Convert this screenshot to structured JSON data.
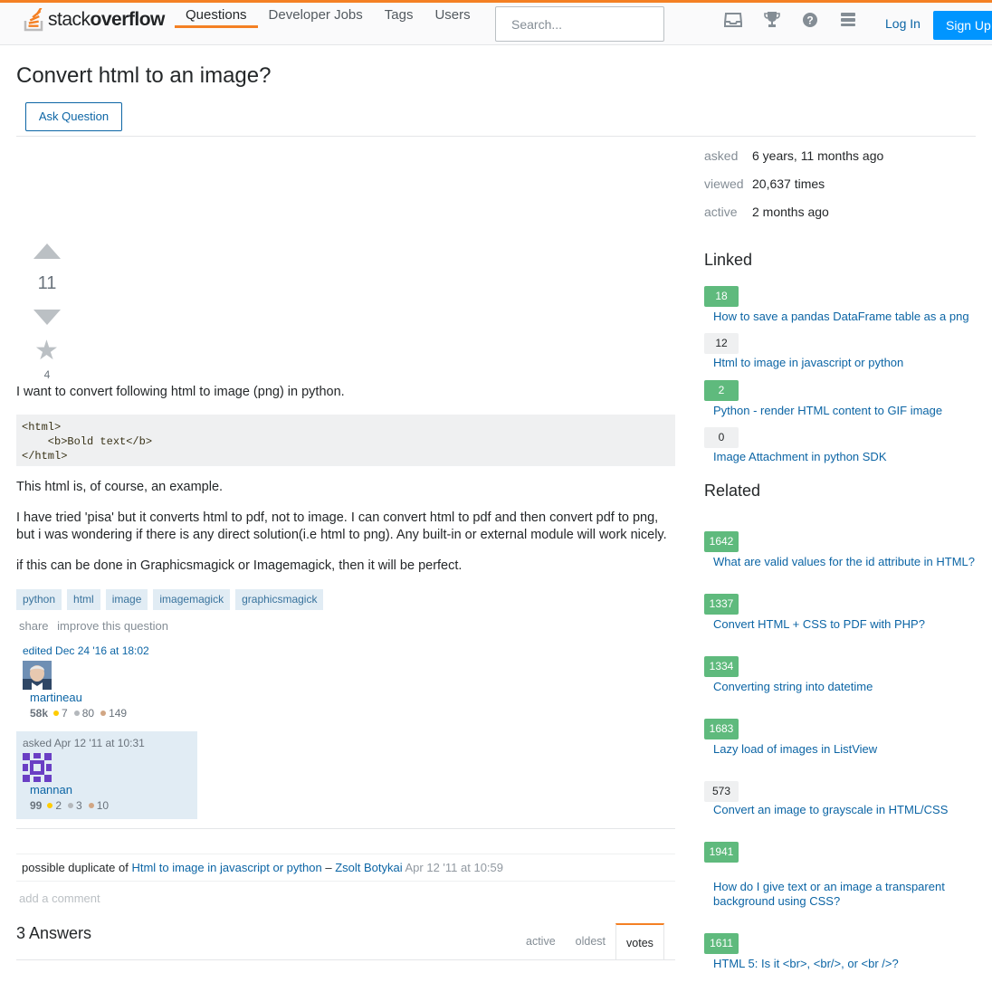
{
  "header": {
    "logo_text_light": "stack",
    "logo_text_bold": "overflow",
    "nav": [
      "Questions",
      "Developer Jobs",
      "Tags",
      "Users"
    ],
    "search_placeholder": "Search...",
    "login": "Log In",
    "signup": "Sign Up",
    "icons": [
      "inbox-icon",
      "trophy-icon",
      "help-icon",
      "site-switcher-icon"
    ]
  },
  "question": {
    "title": "Convert html to an image?",
    "ask_button": "Ask Question",
    "votes": "11",
    "favorites": "4",
    "p1": "I want to convert following html to image (png) in python.",
    "code": "<html>\n    <b>Bold text</b>\n</html>",
    "p2": "This html is, of course, an example.",
    "p3": "I have tried 'pisa' but it converts html to pdf, not to image. I can convert html to pdf and then convert pdf to png, but i was wondering if there is any direct solution(i.e html to png). Any built-in or external module will work nicely.",
    "p4": "if this can be done in Graphicsmagick or Imagemagick, then it will be perfect.",
    "tags": [
      "python",
      "html",
      "image",
      "imagemagick",
      "graphicsmagick"
    ],
    "menu": [
      "share",
      "improve this question"
    ],
    "edited": {
      "action": "edited Dec 24 '16 at 18:02",
      "user": "martineau",
      "rep": "58k",
      "gold": "7",
      "silver": "80",
      "bronze": "149"
    },
    "asked": {
      "action": "asked Apr 12 '11 at 10:31",
      "user": "mannan",
      "rep": "99",
      "gold": "2",
      "silver": "3",
      "bronze": "10"
    }
  },
  "comment": {
    "prefix": "possible duplicate of",
    "link": "Html to image in javascript or python",
    "dash": "–",
    "author": "Zsolt Botykai",
    "time": "Apr 12 '11 at 10:59"
  },
  "add_comment": "add a comment",
  "answers": {
    "title": "3 Answers",
    "tabs": [
      "active",
      "oldest",
      "votes"
    ],
    "active_tab": "votes"
  },
  "sidebar": {
    "meta": [
      {
        "label": "asked",
        "value": "6 years, 11 months ago"
      },
      {
        "label": "viewed",
        "value": "20,637 times"
      },
      {
        "label": "active",
        "value": "2 months ago"
      }
    ],
    "linked_title": "Linked",
    "linked": [
      {
        "score": "18",
        "accepted": true,
        "title": "How to save a pandas DataFrame table as a png"
      },
      {
        "score": "12",
        "accepted": false,
        "title": "Html to image in javascript or python"
      },
      {
        "score": "2",
        "accepted": true,
        "title": "Python - render HTML content to GIF image"
      },
      {
        "score": "0",
        "accepted": false,
        "title": "Image Attachment in python SDK"
      }
    ],
    "related_title": "Related",
    "related": [
      {
        "score": "1642",
        "accepted": true,
        "title": "What are valid values for the id attribute in HTML?"
      },
      {
        "score": "1337",
        "accepted": true,
        "title": "Convert HTML + CSS to PDF with PHP?"
      },
      {
        "score": "1334",
        "accepted": true,
        "title": "Converting string into datetime"
      },
      {
        "score": "1683",
        "accepted": true,
        "title": "Lazy load of images in ListView"
      },
      {
        "score": "573",
        "accepted": false,
        "title": "Convert an image to grayscale in HTML/CSS"
      },
      {
        "score": "1941",
        "accepted": true,
        "title": "How do I give text or an image a transparent background using CSS?"
      },
      {
        "score": "1611",
        "accepted": true,
        "title": "HTML 5: Is it <br>, <br/>, or <br />?"
      }
    ]
  },
  "colors": {
    "accent_orange": "#f48024",
    "link_blue": "#0c65a5",
    "accepted_green": "#5fba7d",
    "signup_blue": "#0095ff",
    "tag_bg": "#e1ecf4"
  }
}
